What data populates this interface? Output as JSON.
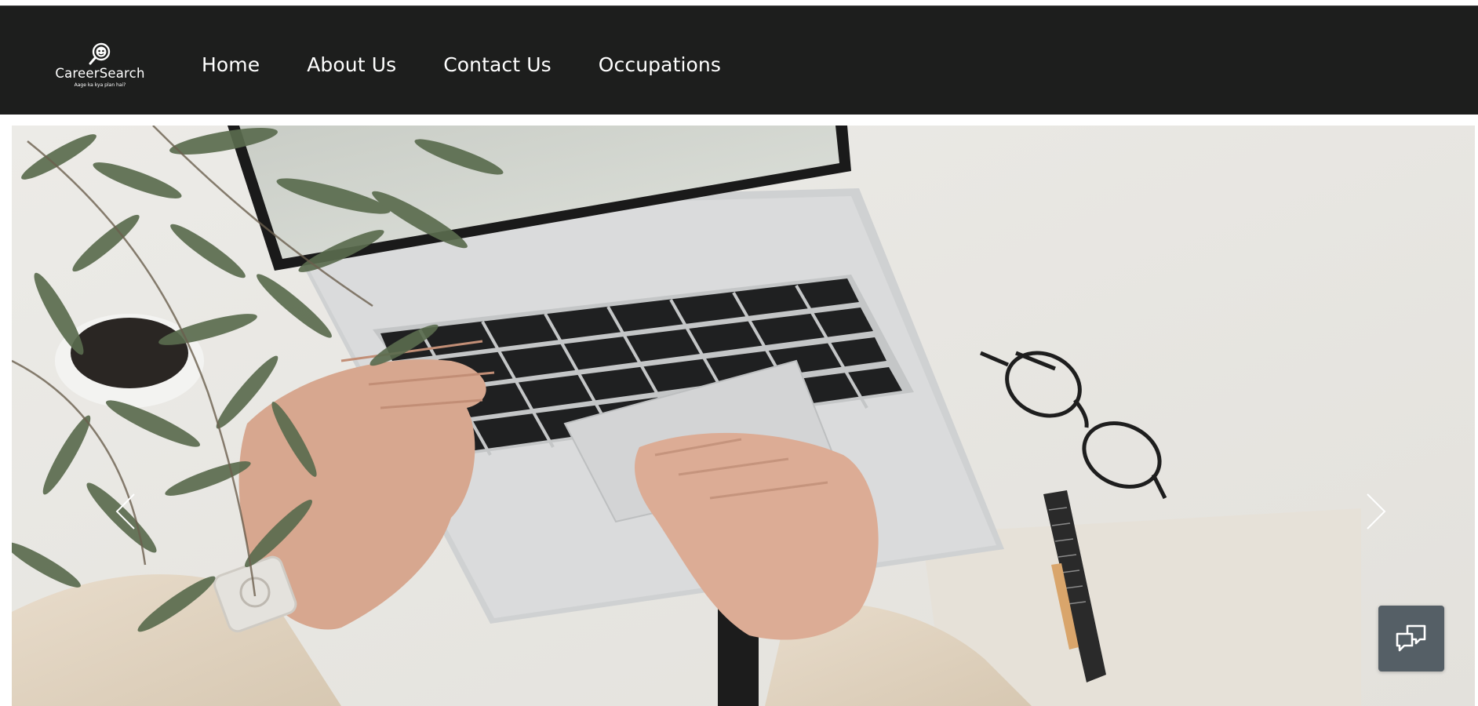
{
  "brand": {
    "name": "CareerSearch",
    "tagline": "Aage ka kya plan hai?"
  },
  "nav": {
    "items": [
      {
        "label": "Home"
      },
      {
        "label": "About Us"
      },
      {
        "label": "Contact Us"
      },
      {
        "label": "Occupations"
      }
    ]
  },
  "carousel": {
    "slide_image": "laptop-typing-desk-photo",
    "prev_icon": "chevron-left-icon",
    "next_icon": "chevron-right-icon"
  },
  "chat_widget": {
    "icon": "chat-bubbles-icon",
    "background_color": "#555f66"
  },
  "colors": {
    "navbar_bg": "#1d1e1d",
    "nav_text": "#ffffff"
  }
}
